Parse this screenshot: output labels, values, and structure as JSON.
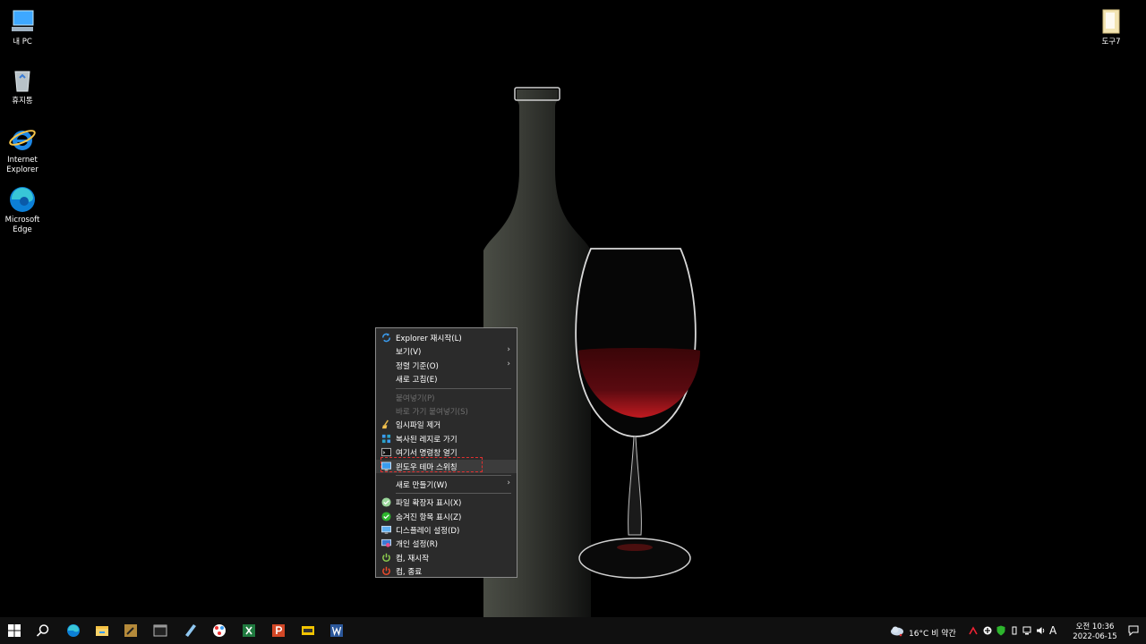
{
  "desktop_icons": [
    {
      "label": "내 PC",
      "icon": "this-pc-icon"
    },
    {
      "label": "휴지통",
      "icon": "recycle-bin-icon"
    },
    {
      "label": "Internet\nExplorer",
      "icon": "internet-explorer-icon"
    },
    {
      "label": "Microsoft\nEdge",
      "icon": "edge-icon"
    },
    {
      "label": "도구7",
      "icon": "folder-icon"
    }
  ],
  "context_menu": {
    "items": [
      {
        "label": "Explorer 재시작(L)",
        "icon": "refresh-icon"
      },
      {
        "label": "보기(V)",
        "submenu": true
      },
      {
        "label": "정렬 기준(O)",
        "submenu": true
      },
      {
        "label": "새로 고침(E)"
      },
      {
        "label": "붙여넣기(P)",
        "disabled": true
      },
      {
        "label": "바로 가기 붙여넣기(S)",
        "disabled": true
      },
      {
        "label": "임시파일 제거",
        "icon": "broom-icon"
      },
      {
        "label": "복사된 레지로 가기",
        "icon": "registry-icon"
      },
      {
        "label": "여기서 명령창 열기",
        "icon": "cmd-icon"
      },
      {
        "label": "윈도우 테마 스위칭",
        "icon": "monitor-icon",
        "highlighted": true
      },
      {
        "label": "새로 만들기(W)",
        "submenu": true
      },
      {
        "label": "파일 확장자 표시(X)",
        "icon": "check-circle-icon"
      },
      {
        "label": "숨겨진 항목 표시(Z)",
        "icon": "check-circle-green-icon"
      },
      {
        "label": "디스플레이 설정(D)",
        "icon": "display-icon"
      },
      {
        "label": "개인 설정(R)",
        "icon": "personalize-icon"
      },
      {
        "label": "컴,   재시작",
        "icon": "power-green-icon"
      },
      {
        "label": "컴,     종료",
        "icon": "power-red-icon"
      }
    ]
  },
  "taskbar": {
    "apps": [
      "start-icon",
      "search-icon",
      "edge-icon",
      "file-explorer-icon",
      "tool-icon",
      "terminal-icon",
      "notepad-icon",
      "paint-icon",
      "excel-icon",
      "powerpoint-icon",
      "hnc-icon",
      "word-icon"
    ],
    "weather": "16°C  비 약간",
    "ime": "A",
    "time": "오전 10:36",
    "date": "2022-06-15"
  },
  "colors": {
    "accent": "#e03030",
    "menu_bg": "#2b2b2b",
    "taskbar_bg": "#101010"
  }
}
